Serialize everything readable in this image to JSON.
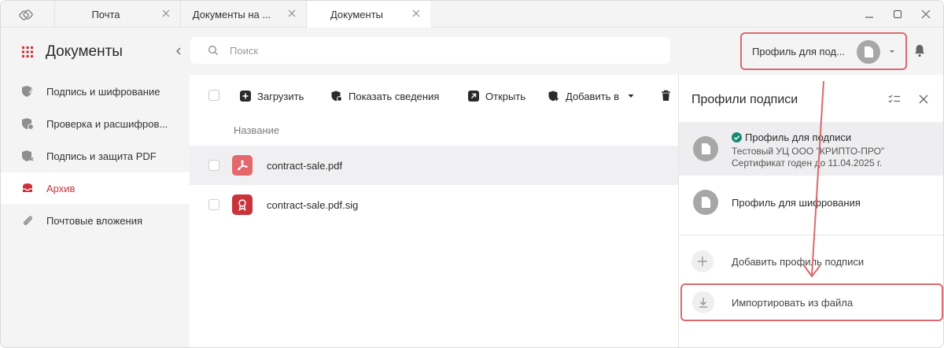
{
  "tabs": [
    {
      "label": "Почта"
    },
    {
      "label": "Документы на ..."
    },
    {
      "label": "Документы"
    }
  ],
  "header": {
    "title": "Документы",
    "search_placeholder": "Поиск",
    "profile_selector_label": "Профиль для под..."
  },
  "sidebar": {
    "items": [
      {
        "label": "Подпись и шифрование",
        "icon": "shield-pen-icon"
      },
      {
        "label": "Проверка и расшифров...",
        "icon": "shield-check-icon"
      },
      {
        "label": "Подпись и защита PDF",
        "icon": "shield-pdf-icon"
      },
      {
        "label": "Архив",
        "icon": "archive-icon",
        "active": true
      },
      {
        "label": "Почтовые вложения",
        "icon": "paperclip-icon"
      }
    ]
  },
  "toolbar": {
    "upload": "Загрузить",
    "show_details": "Показать сведения",
    "open": "Открыть",
    "add_to": "Добавить в"
  },
  "file_list": {
    "column_name": "Название",
    "files": [
      {
        "name": "contract-sale.pdf",
        "icon": "pdf-file-icon",
        "color": "#e4686b"
      },
      {
        "name": "contract-sale.pdf.sig",
        "icon": "signature-file-icon",
        "color": "#c9343a"
      }
    ]
  },
  "panel": {
    "title": "Профили подписи",
    "profiles": [
      {
        "title": "Профиль для подписи",
        "line1": "Тестовый УЦ ООО \"КРИПТО-ПРО\"",
        "line2": "Сертификат годен до 11.04.2025 г.",
        "default": true
      },
      {
        "title": "Профиль для шифрования"
      }
    ],
    "add_profile": "Добавить профиль подписи",
    "import_from_file": "Импортировать из файла"
  },
  "colors": {
    "accent_red": "#c9343a",
    "highlight_border": "#d86a6f",
    "check_green": "#138a72"
  }
}
